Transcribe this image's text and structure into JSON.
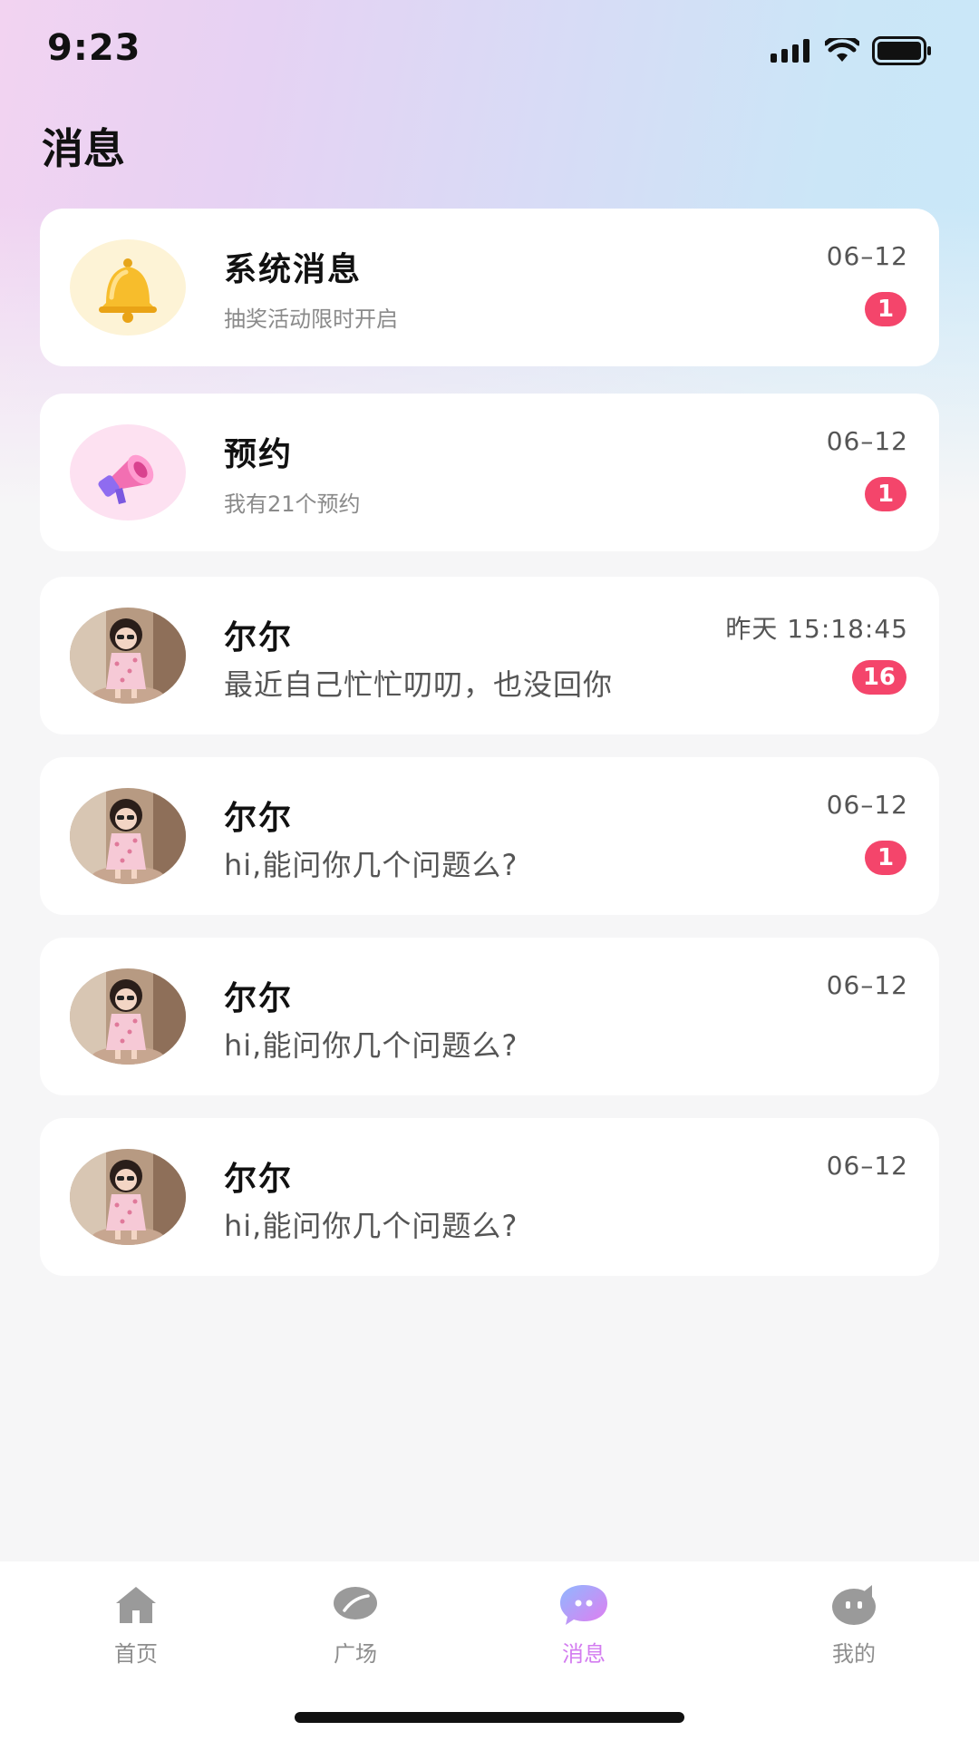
{
  "status_bar": {
    "time": "9:23"
  },
  "header": {
    "title": "消息"
  },
  "messages": [
    {
      "name": "系统消息",
      "preview": "抽奖活动限时开启",
      "time": "06–12",
      "badge": "1",
      "avatar": "bell-icon"
    },
    {
      "name": "预约",
      "preview": "我有21个预约",
      "time": "06–12",
      "badge": "1",
      "avatar": "megaphone-icon"
    },
    {
      "name": "尔尔",
      "preview": "最近自己忙忙叨叨，也没回你",
      "time": "昨天 15:18:45",
      "badge": "16",
      "avatar": "user-avatar"
    },
    {
      "name": "尔尔",
      "preview": "hi,能问你几个问题么?",
      "time": "06–12",
      "badge": "1",
      "avatar": "user-avatar"
    },
    {
      "name": "尔尔",
      "preview": "hi,能问你几个问题么?",
      "time": "06–12",
      "avatar": "user-avatar"
    },
    {
      "name": "尔尔",
      "preview": "hi,能问你几个问题么?",
      "time": "06–12",
      "avatar": "user-avatar"
    }
  ],
  "tabbar": {
    "items": [
      {
        "label": "首页",
        "icon": "home-icon"
      },
      {
        "label": "广场",
        "icon": "leaf-icon"
      },
      {
        "label": "消息",
        "icon": "chat-bubble-icon",
        "active": true
      },
      {
        "label": "我的",
        "icon": "face-icon"
      }
    ]
  },
  "colors": {
    "badge": "#f4456b",
    "accent": "#d37cf0"
  }
}
